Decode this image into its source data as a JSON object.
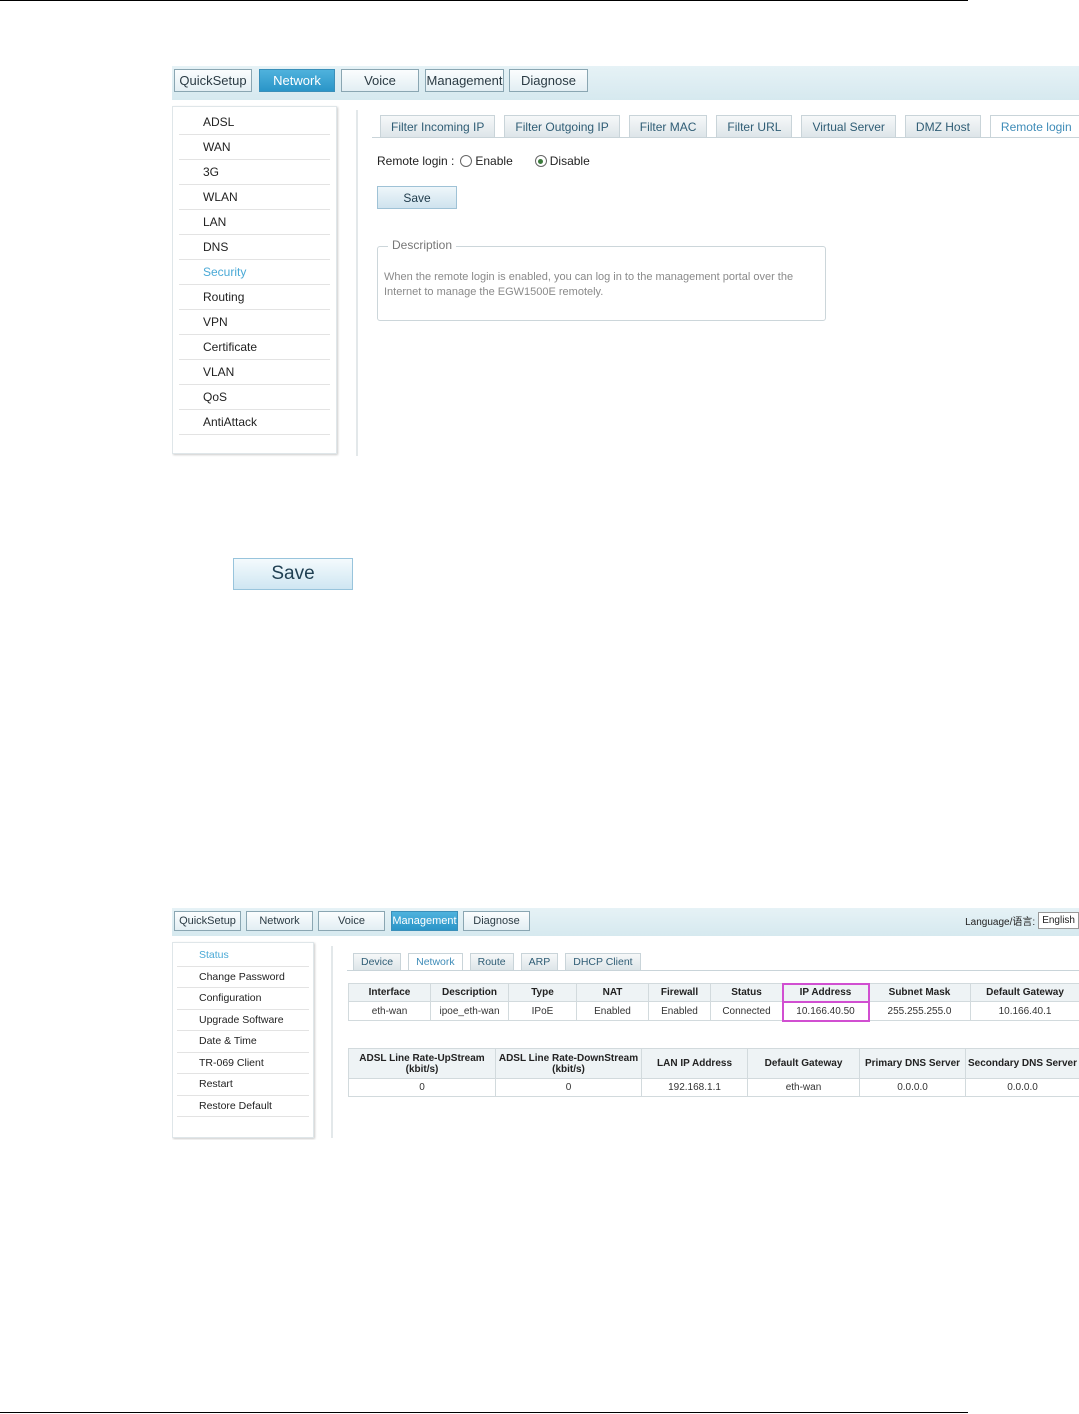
{
  "screenshot1": {
    "topnav": [
      "QuickSetup",
      "Network",
      "Voice",
      "Management",
      "Diagnose"
    ],
    "topnav_active": "Network",
    "sidebar": [
      "ADSL",
      "WAN",
      "3G",
      "WLAN",
      "LAN",
      "DNS",
      "Security",
      "Routing",
      "VPN",
      "Certificate",
      "VLAN",
      "QoS",
      "AntiAttack"
    ],
    "sidebar_active": "Security",
    "tabs": [
      "Filter Incoming IP",
      "Filter Outgoing IP",
      "Filter MAC",
      "Filter URL",
      "Virtual Server",
      "DMZ Host",
      "Remote login"
    ],
    "tab_active": "Remote login",
    "remote_login": {
      "label": "Remote login :",
      "enable_label": "Enable",
      "disable_label": "Disable",
      "selected": "Disable"
    },
    "save_label": "Save",
    "description": {
      "legend": "Description",
      "text": "When the remote login is enabled, you can log in to the management portal over the Internet to manage the EGW1500E remotely."
    }
  },
  "standalone_save_label": "Save",
  "screenshot2": {
    "topnav": [
      "QuickSetup",
      "Network",
      "Voice",
      "Management",
      "Diagnose"
    ],
    "topnav_active": "Management",
    "language_label": "Language/语言:",
    "language_value": "English",
    "sidebar": [
      "Status",
      "Change Password",
      "Configuration",
      "Upgrade Software",
      "Date & Time",
      "TR-069 Client",
      "Restart",
      "Restore Default"
    ],
    "sidebar_active": "Status",
    "tabs": [
      "Device",
      "Network",
      "Route",
      "ARP",
      "DHCP Client"
    ],
    "tab_active": "Network",
    "wan_table": {
      "headers": [
        "Interface",
        "Description",
        "Type",
        "NAT",
        "Firewall",
        "Status",
        "IP Address",
        "Subnet Mask",
        "Default Gateway"
      ],
      "rows": [
        [
          "eth-wan",
          "ipoe_eth-wan",
          "IPoE",
          "Enabled",
          "Enabled",
          "Connected",
          "10.166.40.50",
          "255.255.255.0",
          "10.166.40.1"
        ]
      ],
      "highlight_column": "IP Address"
    },
    "lan_table": {
      "headers": [
        "ADSL Line Rate-UpStream (kbit/s)",
        "ADSL Line Rate-DownStream (kbit/s)",
        "LAN IP Address",
        "Default Gateway",
        "Primary DNS Server",
        "Secondary DNS Server"
      ],
      "rows": [
        [
          "0",
          "0",
          "192.168.1.1",
          "eth-wan",
          "0.0.0.0",
          "0.0.0.0"
        ]
      ]
    }
  }
}
